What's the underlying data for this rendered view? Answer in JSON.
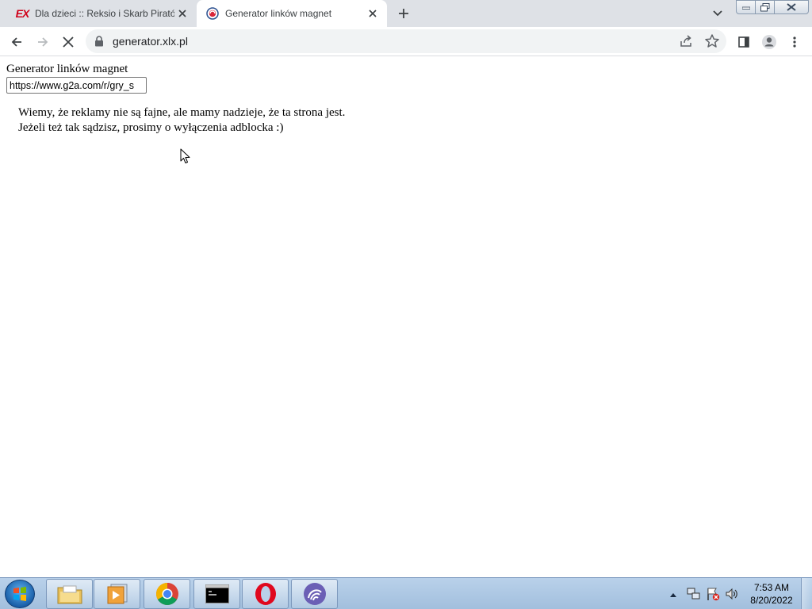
{
  "browser": {
    "tabs": [
      {
        "title": "Dla dzieci :: Reksio i Skarb Piratów",
        "favicon": "ex-logo",
        "active": false
      },
      {
        "title": "Generator linków magnet",
        "favicon": "globe-icon",
        "active": true
      }
    ],
    "ex_logo_text": "EX",
    "address": "generator.xlx.pl"
  },
  "page": {
    "heading": "Generator linków magnet",
    "input_value": "https://www.g2a.com/r/gry_s",
    "message_line1": "Wiemy, że reklamy nie są fajne, ale mamy nadzieje, że ta strona jest.",
    "message_line2": "Jeżeli też tak sądzisz, prosimy o wyłączenia adblocka :)"
  },
  "taskbar": {
    "time": "7:53 AM",
    "date": "8/20/2022"
  },
  "colors": {
    "tabstrip": "#dee1e6",
    "omnibox": "#f1f3f4",
    "taskbar": "#b9d1ea",
    "ex_red": "#d0021b"
  }
}
